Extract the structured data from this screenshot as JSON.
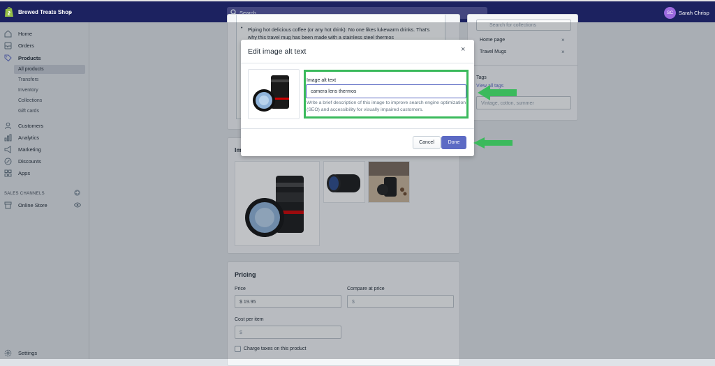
{
  "topbar": {
    "shop_name": "Brewed Treats Shop",
    "search_placeholder": "Search",
    "avatar_initials": "SC",
    "user_name": "Sarah Chrisp"
  },
  "sidebar": {
    "items": [
      {
        "label": "Home",
        "icon": "home-icon"
      },
      {
        "label": "Orders",
        "icon": "orders-icon"
      },
      {
        "label": "Products",
        "icon": "tag-icon"
      }
    ],
    "product_subitems": [
      "All products",
      "Transfers",
      "Inventory",
      "Collections",
      "Gift cards"
    ],
    "items2": [
      {
        "label": "Customers",
        "icon": "person-icon"
      },
      {
        "label": "Analytics",
        "icon": "chart-icon"
      },
      {
        "label": "Marketing",
        "icon": "megaphone-icon"
      },
      {
        "label": "Discounts",
        "icon": "discount-icon"
      },
      {
        "label": "Apps",
        "icon": "apps-icon"
      }
    ],
    "sales_channels_label": "SALES CHANNELS",
    "online_store_label": "Online Store",
    "settings_label": "Settings"
  },
  "description": {
    "bullet_text": "Piping hot delicious coffee (or any hot drink): No one likes lukewarm drinks. That's why this travel mug has been made with a stainless steel thermos"
  },
  "organization": {
    "collections_search_placeholder": "Search for collections",
    "collections": [
      "Home page",
      "Travel Mugs"
    ],
    "tags_label": "Tags",
    "view_all_tags": "View all tags",
    "tags_placeholder": "Vintage, cotton, summer"
  },
  "images_card": {
    "title_partial": "Im"
  },
  "pricing": {
    "title": "Pricing",
    "price_label": "Price",
    "price_value": "$ 19.95",
    "compare_label": "Compare at price",
    "compare_value": "$",
    "cost_label": "Cost per item",
    "cost_value": "$",
    "charge_taxes_label": "Charge taxes on this product"
  },
  "modal": {
    "title": "Edit image alt text",
    "close": "×",
    "alt_label": "Image alt text",
    "alt_value": "camera lens thermos",
    "help_text": "Write a brief description of this image to improve search engine optimization (SEO) and accessibility for visually impaired customers.",
    "cancel": "Cancel",
    "done": "Done"
  },
  "colors": {
    "topbar": "#1c2260",
    "accent": "#5c6ac4",
    "annotation_green": "#3bba5c"
  }
}
